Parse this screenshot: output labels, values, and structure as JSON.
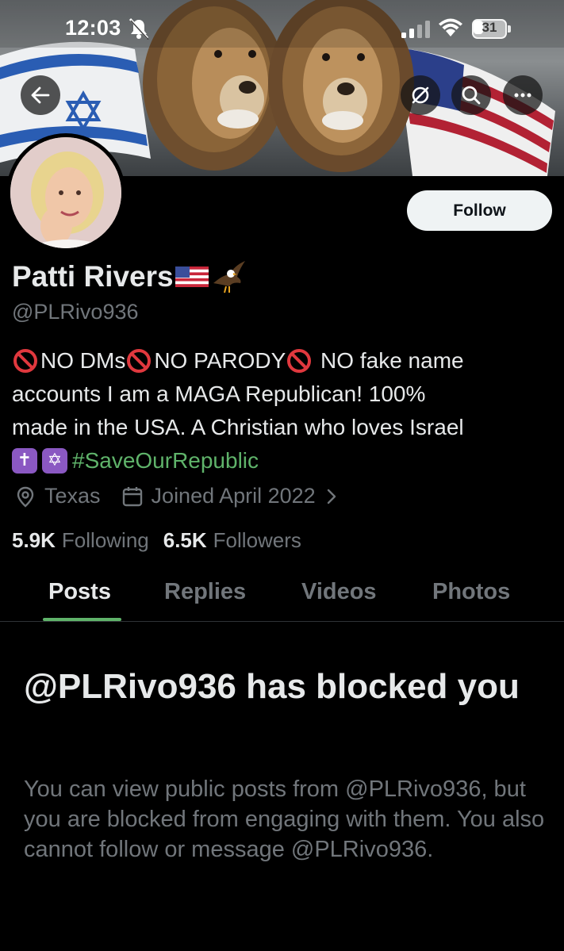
{
  "status_bar": {
    "time": "12:03",
    "battery_level": "31",
    "battery_fraction": 0.31
  },
  "header": {
    "icons": [
      "back-arrow-icon",
      "grok-icon",
      "search-icon",
      "more-icon"
    ]
  },
  "profile": {
    "display_name": "Patti Rivers",
    "handle": "@PLRivo936",
    "follow_label": "Follow",
    "bio": {
      "line1_parts": [
        "NO DMs",
        "NO PARODY",
        " NO fake name"
      ],
      "line2": "accounts I am a MAGA Republican! 100%",
      "line3": "made in the USA. A Christian who loves Israel",
      "line4_emojis": [
        "✝",
        "✡"
      ],
      "hashtag": "#SaveOurRepublic"
    },
    "location": "Texas",
    "joined": "Joined April 2022",
    "following_count": "5.9K",
    "following_label": "Following",
    "followers_count": "6.5K",
    "followers_label": "Followers"
  },
  "tabs": [
    {
      "label": "Posts",
      "active": true
    },
    {
      "label": "Replies",
      "active": false
    },
    {
      "label": "Videos",
      "active": false
    },
    {
      "label": "Photos",
      "active": false
    }
  ],
  "blocked": {
    "title": "@PLRivo936 has blocked you",
    "body": "You can view public posts from @PLRivo936, but you are blocked from engaging with them. You also cannot follow or message @PLRivo936."
  },
  "colors": {
    "background": "#000000",
    "text_primary": "#e7e9ea",
    "text_secondary": "#71767b",
    "hashtag": "#5fb36a",
    "tab_indicator": "#5fb36a",
    "follow_button_bg": "#eff3f4"
  }
}
